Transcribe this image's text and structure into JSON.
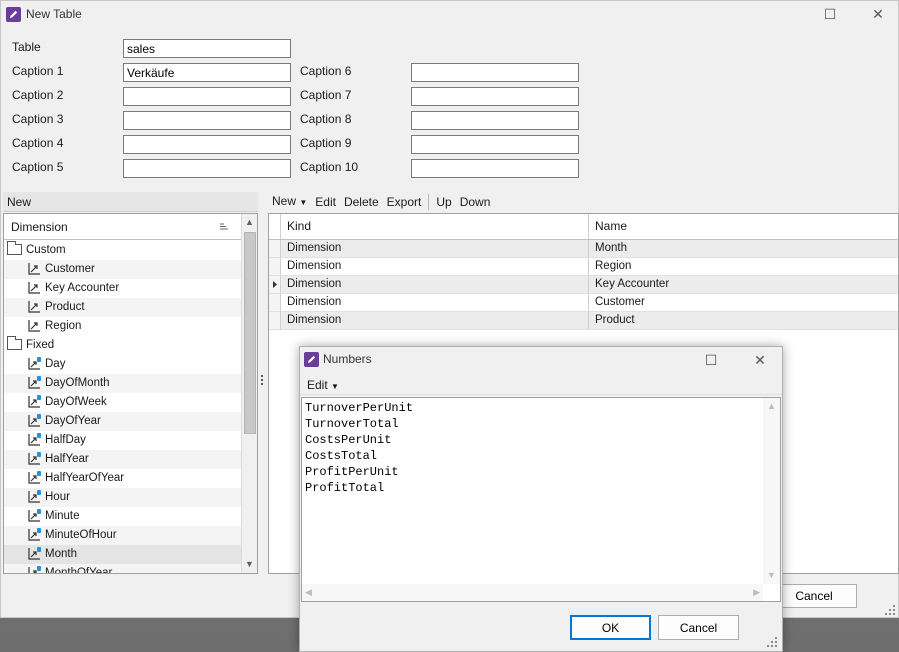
{
  "main_window": {
    "title": "New Table",
    "controls": {
      "maximize": "☐",
      "close": "✕"
    }
  },
  "form": {
    "table_label": "Table",
    "table_value": "sales",
    "captions": [
      {
        "label": "Caption 1",
        "value": "Verkäufe"
      },
      {
        "label": "Caption 2",
        "value": ""
      },
      {
        "label": "Caption 3",
        "value": ""
      },
      {
        "label": "Caption 4",
        "value": ""
      },
      {
        "label": "Caption 5",
        "value": ""
      },
      {
        "label": "Caption 6",
        "value": ""
      },
      {
        "label": "Caption 7",
        "value": ""
      },
      {
        "label": "Caption 8",
        "value": ""
      },
      {
        "label": "Caption 9",
        "value": ""
      },
      {
        "label": "Caption 10",
        "value": ""
      }
    ]
  },
  "left_panel": {
    "header": "New",
    "column_header": "Dimension",
    "groups": [
      {
        "name": "Custom",
        "items": [
          "Customer",
          "Key Accounter",
          "Product",
          "Region"
        ]
      },
      {
        "name": "Fixed",
        "items": [
          "Day",
          "DayOfMonth",
          "DayOfWeek",
          "DayOfYear",
          "HalfDay",
          "HalfYear",
          "HalfYearOfYear",
          "Hour",
          "Minute",
          "MinuteOfHour",
          "Month",
          "MonthOfYear"
        ]
      }
    ]
  },
  "right_panel": {
    "toolbar": [
      "New",
      "Edit",
      "Delete",
      "Export",
      "Up",
      "Down"
    ],
    "columns": [
      "Kind",
      "Name"
    ],
    "rows": [
      {
        "kind": "Dimension",
        "name": "Month"
      },
      {
        "kind": "Dimension",
        "name": "Region"
      },
      {
        "kind": "Dimension",
        "name": "Key Accounter"
      },
      {
        "kind": "Dimension",
        "name": "Customer"
      },
      {
        "kind": "Dimension",
        "name": "Product"
      }
    ],
    "current_row": 2
  },
  "main_buttons": {
    "cancel": "Cancel"
  },
  "numbers_dialog": {
    "title": "Numbers",
    "menu_edit": "Edit",
    "lines": [
      "TurnoverPerUnit",
      "TurnoverTotal",
      "CostsPerUnit",
      "CostsTotal",
      "ProfitPerUnit",
      "ProfitTotal"
    ],
    "ok": "OK",
    "cancel": "Cancel"
  },
  "colors": {
    "accent": "#6a3d9a",
    "focus_border": "#0078d7"
  }
}
